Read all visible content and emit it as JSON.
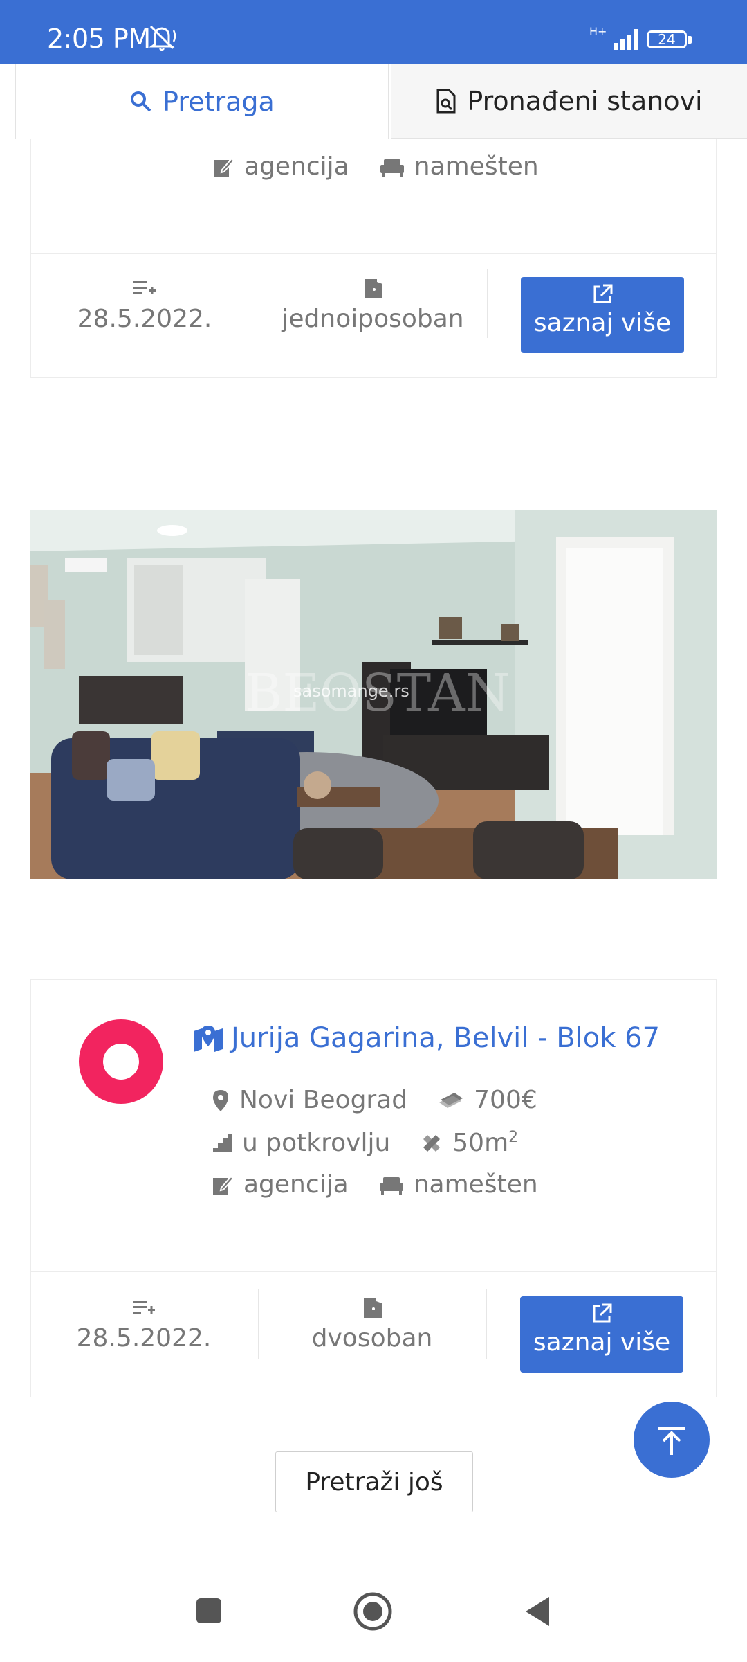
{
  "status_bar": {
    "time": "2:05 PM",
    "network": "H+",
    "battery": "24"
  },
  "tabs": {
    "search": "Pretraga",
    "found": "Pronađeni stanovi"
  },
  "listings": [
    {
      "agency": "agencija",
      "furnished": "namešten",
      "date": "28.5.2022.",
      "rooms": "jednoiposoban",
      "more": "saznaj više"
    },
    {
      "title": "Jurija Gagarina, Belvil - Blok 67",
      "municipality": "Novi Beograd",
      "price": "700€",
      "floor": "u potkrovlju",
      "area": "50m",
      "area_sup": "2",
      "agency": "agencija",
      "furnished": "namešten",
      "date": "28.5.2022.",
      "rooms": "dvosoban",
      "more": "saznaj više",
      "photo_watermark": "BEOSTAN",
      "photo_watermark_site": "sasomange.rs"
    }
  ],
  "search_more": "Pretraži još",
  "colors": {
    "primary": "#3a6fd3",
    "pin": "#f2245f"
  }
}
